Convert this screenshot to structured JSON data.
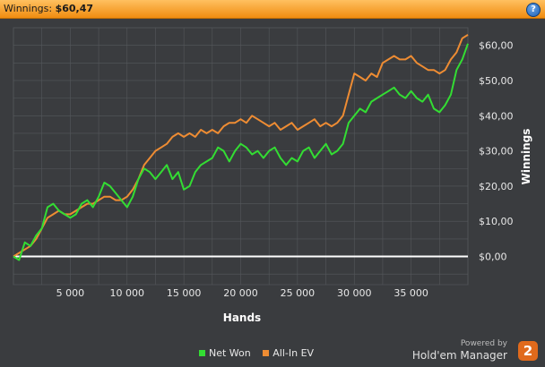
{
  "header": {
    "winnings_label": "Winnings:",
    "winnings_value": "$60,47"
  },
  "help": {
    "icon": "help-icon",
    "glyph": "?"
  },
  "branding": {
    "powered_by": "Powered by",
    "product": "Hold'em Manager",
    "logo_text": "2"
  },
  "colors": {
    "net_won": "#33dd33",
    "all_in_ev": "#ee8c33",
    "plot_bg": "#3a3c3f",
    "grid": "#55585c",
    "zero_line": "#ffffff"
  },
  "chart_data": {
    "type": "line",
    "title": "",
    "xlabel": "Hands",
    "ylabel": "Winnings",
    "xlim": [
      0,
      40000
    ],
    "ylim": [
      -8,
      65
    ],
    "x_ticks": [
      5000,
      10000,
      15000,
      20000,
      25000,
      30000,
      35000
    ],
    "x_tick_labels": [
      "5 000",
      "10 000",
      "15 000",
      "20 000",
      "25 000",
      "30 000",
      "35 000"
    ],
    "y_ticks": [
      0,
      10,
      20,
      30,
      40,
      50,
      60
    ],
    "y_tick_labels": [
      "$0,00",
      "$10,00",
      "$20,00",
      "$30,00",
      "$40,00",
      "$50,00",
      "$60,00"
    ],
    "grid": true,
    "legend_position": "bottom-center",
    "series": [
      {
        "name": "Net Won",
        "color": "#33dd33",
        "x": [
          0,
          500,
          1000,
          1500,
          2000,
          2500,
          3000,
          3500,
          4000,
          4500,
          5000,
          5500,
          6000,
          6500,
          7000,
          7500,
          8000,
          8500,
          9000,
          9500,
          10000,
          10500,
          11000,
          11500,
          12000,
          12500,
          13000,
          13500,
          14000,
          14500,
          15000,
          15500,
          16000,
          16500,
          17000,
          17500,
          18000,
          18500,
          19000,
          19500,
          20000,
          20500,
          21000,
          21500,
          22000,
          22500,
          23000,
          23500,
          24000,
          24500,
          25000,
          25500,
          26000,
          26500,
          27000,
          27500,
          28000,
          28500,
          29000,
          29500,
          30000,
          30500,
          31000,
          31500,
          32000,
          32500,
          33000,
          33500,
          34000,
          34500,
          35000,
          35500,
          36000,
          36500,
          37000,
          37500,
          38000,
          38500,
          39000,
          39500,
          40000
        ],
        "y": [
          0,
          -1,
          4,
          3,
          6,
          8,
          14,
          15,
          13,
          12,
          11,
          12,
          15,
          16,
          14,
          17,
          21,
          20,
          18,
          16,
          14,
          17,
          22,
          25,
          24,
          22,
          24,
          26,
          22,
          24,
          19,
          20,
          24,
          26,
          27,
          28,
          31,
          30,
          27,
          30,
          32,
          31,
          29,
          30,
          28,
          30,
          31,
          28,
          26,
          28,
          27,
          30,
          31,
          28,
          30,
          32,
          29,
          30,
          32,
          38,
          40,
          42,
          41,
          44,
          45,
          46,
          47,
          48,
          46,
          45,
          47,
          45,
          44,
          46,
          42,
          41,
          43,
          46,
          53,
          56,
          60.47
        ]
      },
      {
        "name": "All-In EV",
        "color": "#ee8c33",
        "x": [
          0,
          500,
          1000,
          1500,
          2000,
          2500,
          3000,
          3500,
          4000,
          4500,
          5000,
          5500,
          6000,
          6500,
          7000,
          7500,
          8000,
          8500,
          9000,
          9500,
          10000,
          10500,
          11000,
          11500,
          12000,
          12500,
          13000,
          13500,
          14000,
          14500,
          15000,
          15500,
          16000,
          16500,
          17000,
          17500,
          18000,
          18500,
          19000,
          19500,
          20000,
          20500,
          21000,
          21500,
          22000,
          22500,
          23000,
          23500,
          24000,
          24500,
          25000,
          25500,
          26000,
          26500,
          27000,
          27500,
          28000,
          28500,
          29000,
          29500,
          30000,
          30500,
          31000,
          31500,
          32000,
          32500,
          33000,
          33500,
          34000,
          34500,
          35000,
          35500,
          36000,
          36500,
          37000,
          37500,
          38000,
          38500,
          39000,
          39500,
          40000
        ],
        "y": [
          0,
          1,
          2,
          3,
          5,
          8,
          11,
          12,
          13,
          12,
          12,
          13,
          14,
          15,
          15,
          16,
          17,
          17,
          16,
          16,
          17,
          19,
          22,
          26,
          28,
          30,
          31,
          32,
          34,
          35,
          34,
          35,
          34,
          36,
          35,
          36,
          35,
          37,
          38,
          38,
          39,
          38,
          40,
          39,
          38,
          37,
          38,
          36,
          37,
          38,
          36,
          37,
          38,
          39,
          37,
          38,
          37,
          38,
          40,
          46,
          52,
          51,
          50,
          52,
          51,
          55,
          56,
          57,
          56,
          56,
          57,
          55,
          54,
          53,
          53,
          52,
          53,
          56,
          58,
          62,
          63
        ]
      }
    ]
  }
}
